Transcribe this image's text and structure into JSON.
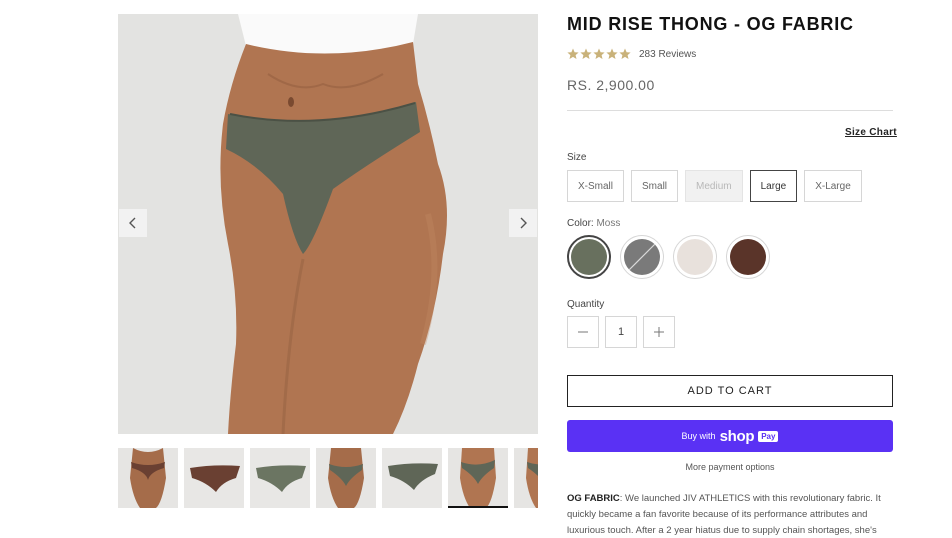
{
  "product": {
    "title": "MID RISE THONG - OG FABRIC",
    "rating": 4.8,
    "reviews_label": "283 Reviews",
    "price": "RS. 2,900.00",
    "size_chart_label": "Size Chart"
  },
  "size": {
    "label": "Size",
    "options": [
      {
        "label": "X-Small",
        "state": "available"
      },
      {
        "label": "Small",
        "state": "available"
      },
      {
        "label": "Medium",
        "state": "unavailable"
      },
      {
        "label": "Large",
        "state": "selected"
      },
      {
        "label": "X-Large",
        "state": "available"
      }
    ]
  },
  "color": {
    "label": "Color:",
    "selected": "Moss",
    "swatches": [
      {
        "color": "#68705e",
        "selected": true
      },
      {
        "color": "#7a7a7a",
        "selected": false
      },
      {
        "color": "#e8e1dc",
        "selected": false
      },
      {
        "color": "#5a3429",
        "selected": false
      }
    ]
  },
  "quantity": {
    "label": "Quantity",
    "value": "1"
  },
  "actions": {
    "add_to_cart": "ADD TO CART",
    "buy_with": "Buy with",
    "shop": "shop",
    "pay": "Pay",
    "more_payment": "More payment options"
  },
  "description": {
    "heading": "OG FABRIC",
    "text": ": We launched JIV ATHLETICS with this revolutionary fabric. It quickly became a fan favorite because of its performance attributes and luxurious touch.  After a 2 year hiatus due to supply chain shortages, she's"
  },
  "colors": {
    "accent_shop_pay": "#5a31f4",
    "star": "#c9b27a",
    "image_bg": "#e3e3e1"
  },
  "icons": {
    "prev": "chevron-left-icon",
    "next": "chevron-right-icon",
    "minus": "minus-icon",
    "plus": "plus-icon",
    "star": "star-icon"
  }
}
